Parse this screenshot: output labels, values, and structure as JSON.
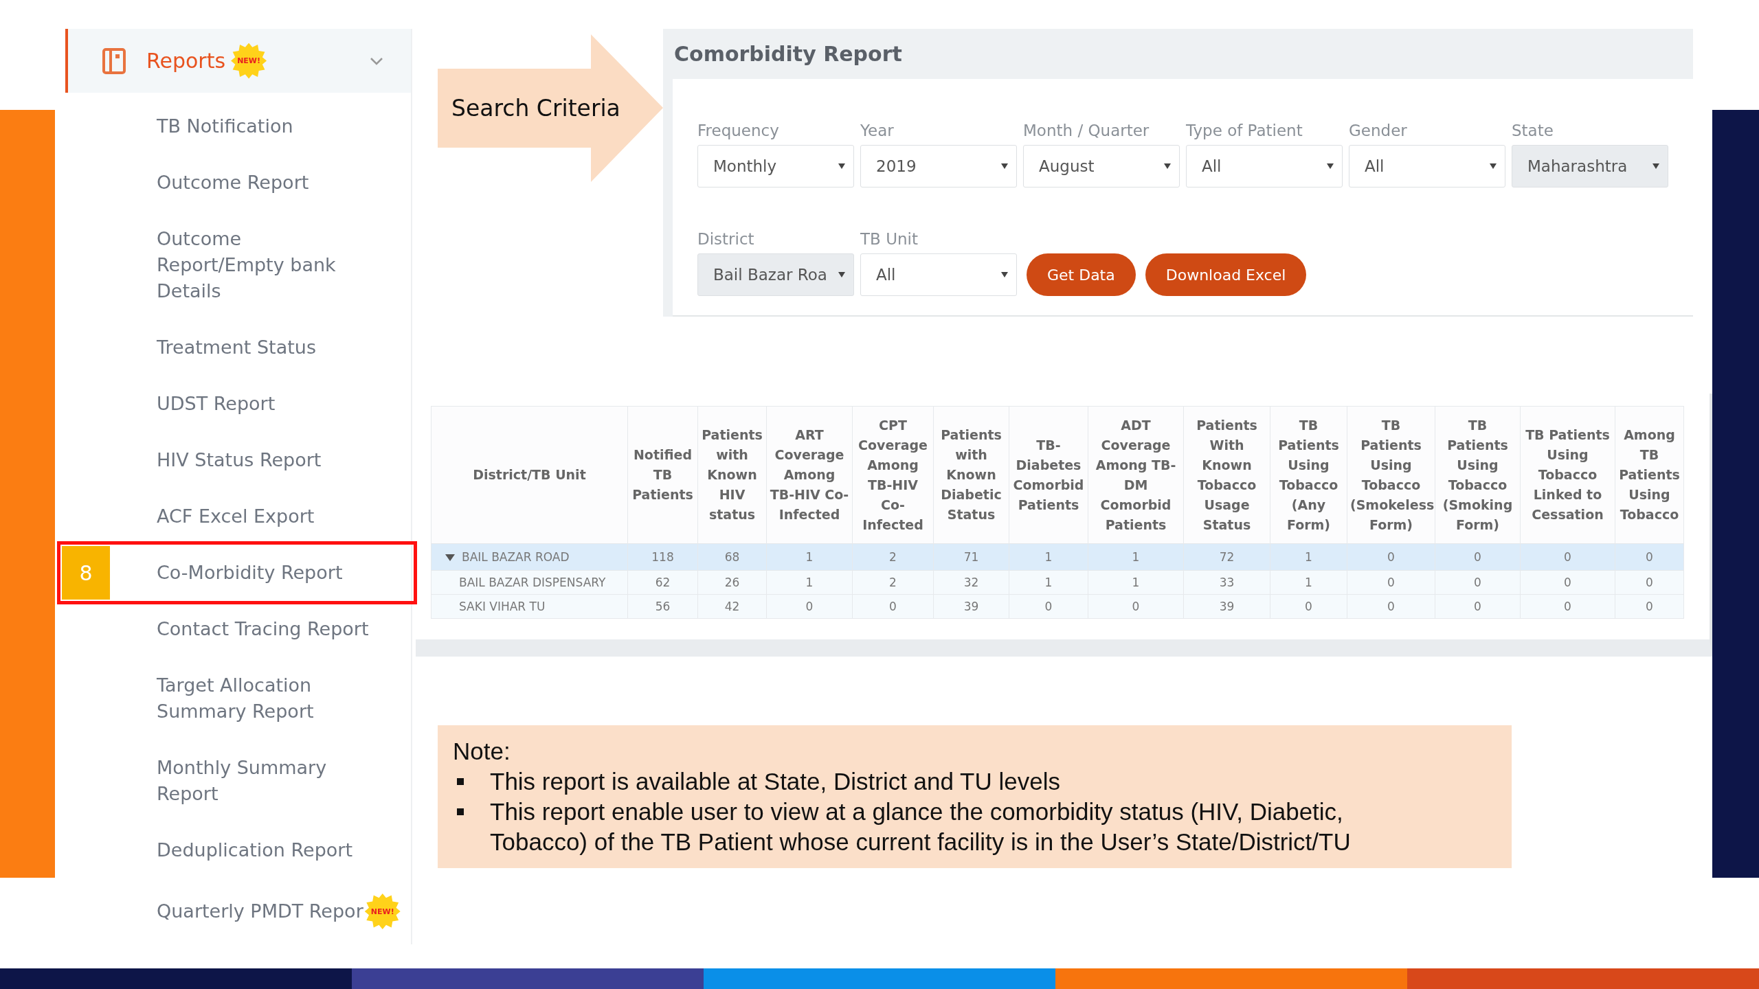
{
  "sidebar": {
    "header": {
      "label": "Reports",
      "badge": "NEW!",
      "expanded": true
    },
    "items": [
      {
        "label": "TB Notification"
      },
      {
        "label": "Outcome Report"
      },
      {
        "label": "Outcome\nReport/Empty bank\nDetails"
      },
      {
        "label": "Treatment Status"
      },
      {
        "label": "UDST Report"
      },
      {
        "label": "HIV Status Report"
      },
      {
        "label": "ACF Excel Export"
      },
      {
        "label": "Co-Morbidity Report",
        "highlighted": true,
        "marker": "8"
      },
      {
        "label": "Contact Tracing Report"
      },
      {
        "label": "Target Allocation\nSummary Report"
      },
      {
        "label": "Monthly Summary\nReport"
      },
      {
        "label": "Deduplication Report"
      },
      {
        "label": "Quarterly PMDT Repor",
        "badge": "NEW!"
      }
    ]
  },
  "callout": "Search Criteria",
  "panel": {
    "title": "Comorbidity Report",
    "filters": [
      {
        "label": "Frequency",
        "value": "Monthly",
        "disabled": false
      },
      {
        "label": "Year",
        "value": "2019",
        "disabled": false
      },
      {
        "label": "Month / Quarter",
        "value": "August",
        "disabled": false
      },
      {
        "label": "Type of Patient",
        "value": "All",
        "disabled": false
      },
      {
        "label": "Gender",
        "value": "All",
        "disabled": false
      },
      {
        "label": "State",
        "value": "Maharashtra",
        "disabled": true
      },
      {
        "label": "District",
        "value": "Bail Bazar Roa",
        "disabled": true
      },
      {
        "label": "TB Unit",
        "value": "All",
        "disabled": false
      }
    ],
    "buttons": [
      "Get Data",
      "Download Excel"
    ]
  },
  "table": {
    "columns": [
      "District/TB Unit",
      "Notified TB Patients",
      "Patients with Known HIV status",
      "ART Coverage Among TB-HIV Co-Infected",
      "CPT Coverage Among TB-HIV Co-Infected",
      "Patients with Known Diabetic Status",
      "TB-Diabetes Comorbid Patients",
      "ADT Coverage Among TB-DM Comorbid Patients",
      "Patients With Known Tobacco Usage Status",
      "TB Patients Using Tobacco (Any Form)",
      "TB Patients Using Tobacco (Smokeless Form)",
      "TB Patients Using Tobacco (Smoking Form)",
      "TB Patients Using Tobacco Linked to Cessation",
      "Among TB Patients Using Tobacco"
    ],
    "rows": [
      {
        "kind": "group",
        "expanded": true,
        "cells": [
          "BAIL BAZAR ROAD",
          "118",
          "68",
          "1",
          "2",
          "71",
          "1",
          "1",
          "72",
          "1",
          "0",
          "0",
          "0",
          "0"
        ]
      },
      {
        "kind": "child",
        "cells": [
          "BAIL BAZAR DISPENSARY",
          "62",
          "26",
          "1",
          "2",
          "32",
          "1",
          "1",
          "33",
          "1",
          "0",
          "0",
          "0",
          "0"
        ]
      },
      {
        "kind": "child",
        "cells": [
          "SAKI VIHAR TU",
          "56",
          "42",
          "0",
          "0",
          "39",
          "0",
          "0",
          "39",
          "0",
          "0",
          "0",
          "0",
          "0"
        ]
      }
    ]
  },
  "note": {
    "title": "Note:",
    "bullets": [
      "This report is available at State, District and TU levels",
      "This report enable user to view at a glance the comorbidity status (HIV, Diabetic, Tobacco) of the TB Patient whose current facility is in the User’s State/District/TU"
    ]
  }
}
